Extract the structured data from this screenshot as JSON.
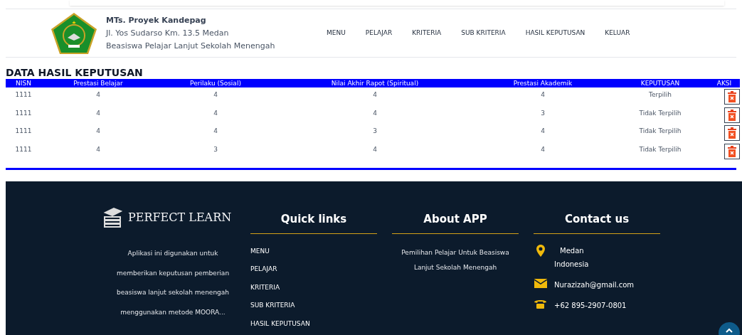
{
  "header": {
    "school": "MTs. Proyek Kandepag",
    "address": "Jl. Yos Sudarso Km. 13.5 Medan",
    "subtitle": "Beasiswa Pelajar Lanjut Sekolah Menengah",
    "nav": [
      "MENU",
      "PELAJAR",
      "KRITERIA",
      "SUB KRITERIA",
      "HASIL KEPUTUSAN",
      "KELUAR"
    ]
  },
  "page_title": "DATA HASIL KEPUTUSAN",
  "table": {
    "columns": [
      "NISN",
      "Prestasi Belajar",
      "Perilaku (Sosial)",
      "Nilai Akhir Rapot (Spiritual)",
      "Prestasi Akademik",
      "KEPUTUSAN",
      "AKSI"
    ],
    "rows": [
      {
        "cells": [
          "1111",
          "4",
          "4",
          "4",
          "4",
          "Terpilih"
        ]
      },
      {
        "cells": [
          "1111",
          "4",
          "4",
          "4",
          "3",
          "Tidak Terpilih"
        ]
      },
      {
        "cells": [
          "1111",
          "4",
          "4",
          "3",
          "4",
          "Tidak Terpilih"
        ]
      },
      {
        "cells": [
          "1111",
          "4",
          "3",
          "4",
          "4",
          "Tidak Terpilih"
        ]
      }
    ]
  },
  "footer": {
    "brand": "PERFECT LEARN",
    "description": "Aplikasi ini digunakan untuk memberikan keputusan pemberian beasiswa lanjut sekolah menengah menggunakan metode MOORA...",
    "quick_links": {
      "title": "Quick links",
      "items": [
        "MENU",
        "PELAJAR",
        "KRITERIA",
        "SUB KRITERIA",
        "HASIL KEPUTUSAN"
      ]
    },
    "about": {
      "title": "About APP",
      "text": "Pemilihan Pelajar Untuk Beasiswa Lanjut Sekolah Menengah"
    },
    "contact": {
      "title": "Contact us",
      "items": [
        {
          "kind": "location",
          "lines": [
            "Medan",
            "Indonesia"
          ]
        },
        {
          "kind": "email",
          "lines": [
            "Nurazizah@gmail.com"
          ]
        },
        {
          "kind": "phone",
          "lines": [
            "+62 895-2907-0801"
          ]
        }
      ]
    }
  }
}
